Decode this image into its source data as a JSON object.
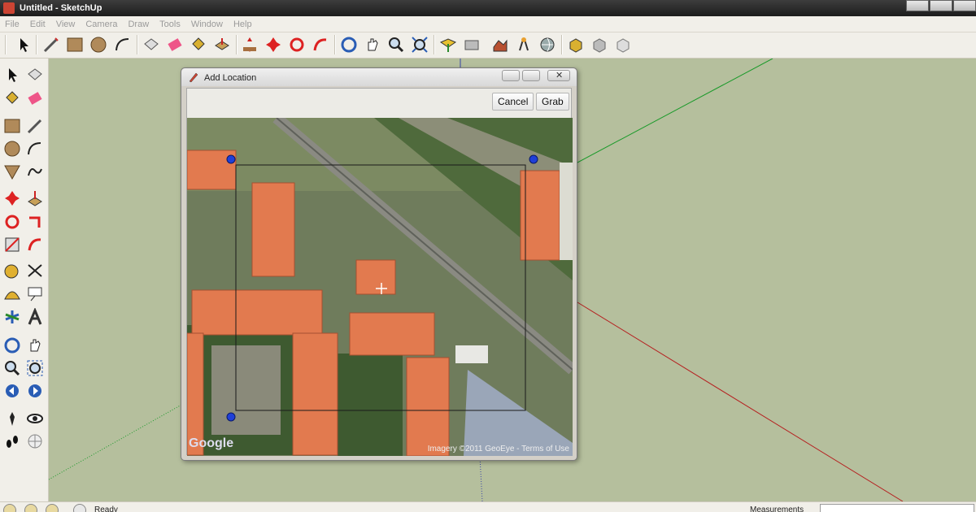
{
  "window": {
    "title": "Untitled - SketchUp"
  },
  "menu": [
    "File",
    "Edit",
    "View",
    "Camera",
    "Draw",
    "Tools",
    "Window",
    "Help"
  ],
  "toolbar_icons": [
    "select-icon",
    "line-icon",
    "rectangle-icon",
    "circle-icon",
    "arc-icon",
    "make-component-icon",
    "eraser-icon",
    "paint-bucket-icon",
    "push-pull-icon",
    "move-icon",
    "rotate-icon",
    "follow-me-icon",
    "orbit-icon",
    "pan-icon",
    "zoom-icon",
    "zoom-extents-icon",
    "add-location-icon",
    "toggle-terrain-icon",
    "get-models-icon",
    "share-model-icon",
    "get-photo-texture-icon",
    "component-icon",
    "share-component-icon",
    "upload-icon"
  ],
  "dialog": {
    "title": "Add Location",
    "cancel_label": "Cancel",
    "grab_label": "Grab",
    "map": {
      "logo": "Google",
      "copyright": "Imagery ©2011 GeoEye - Terms of Use"
    }
  },
  "status": {
    "text": "Ready",
    "measurements_label": "Measurements"
  },
  "colors": {
    "viewport_bg": "#b5bf9d",
    "toolbar_bg": "#f1efe9",
    "roof": "#e27a4f",
    "green_axis": "#1a9a2a",
    "red_axis": "#b52020",
    "blue_axis": "#3844a8"
  }
}
